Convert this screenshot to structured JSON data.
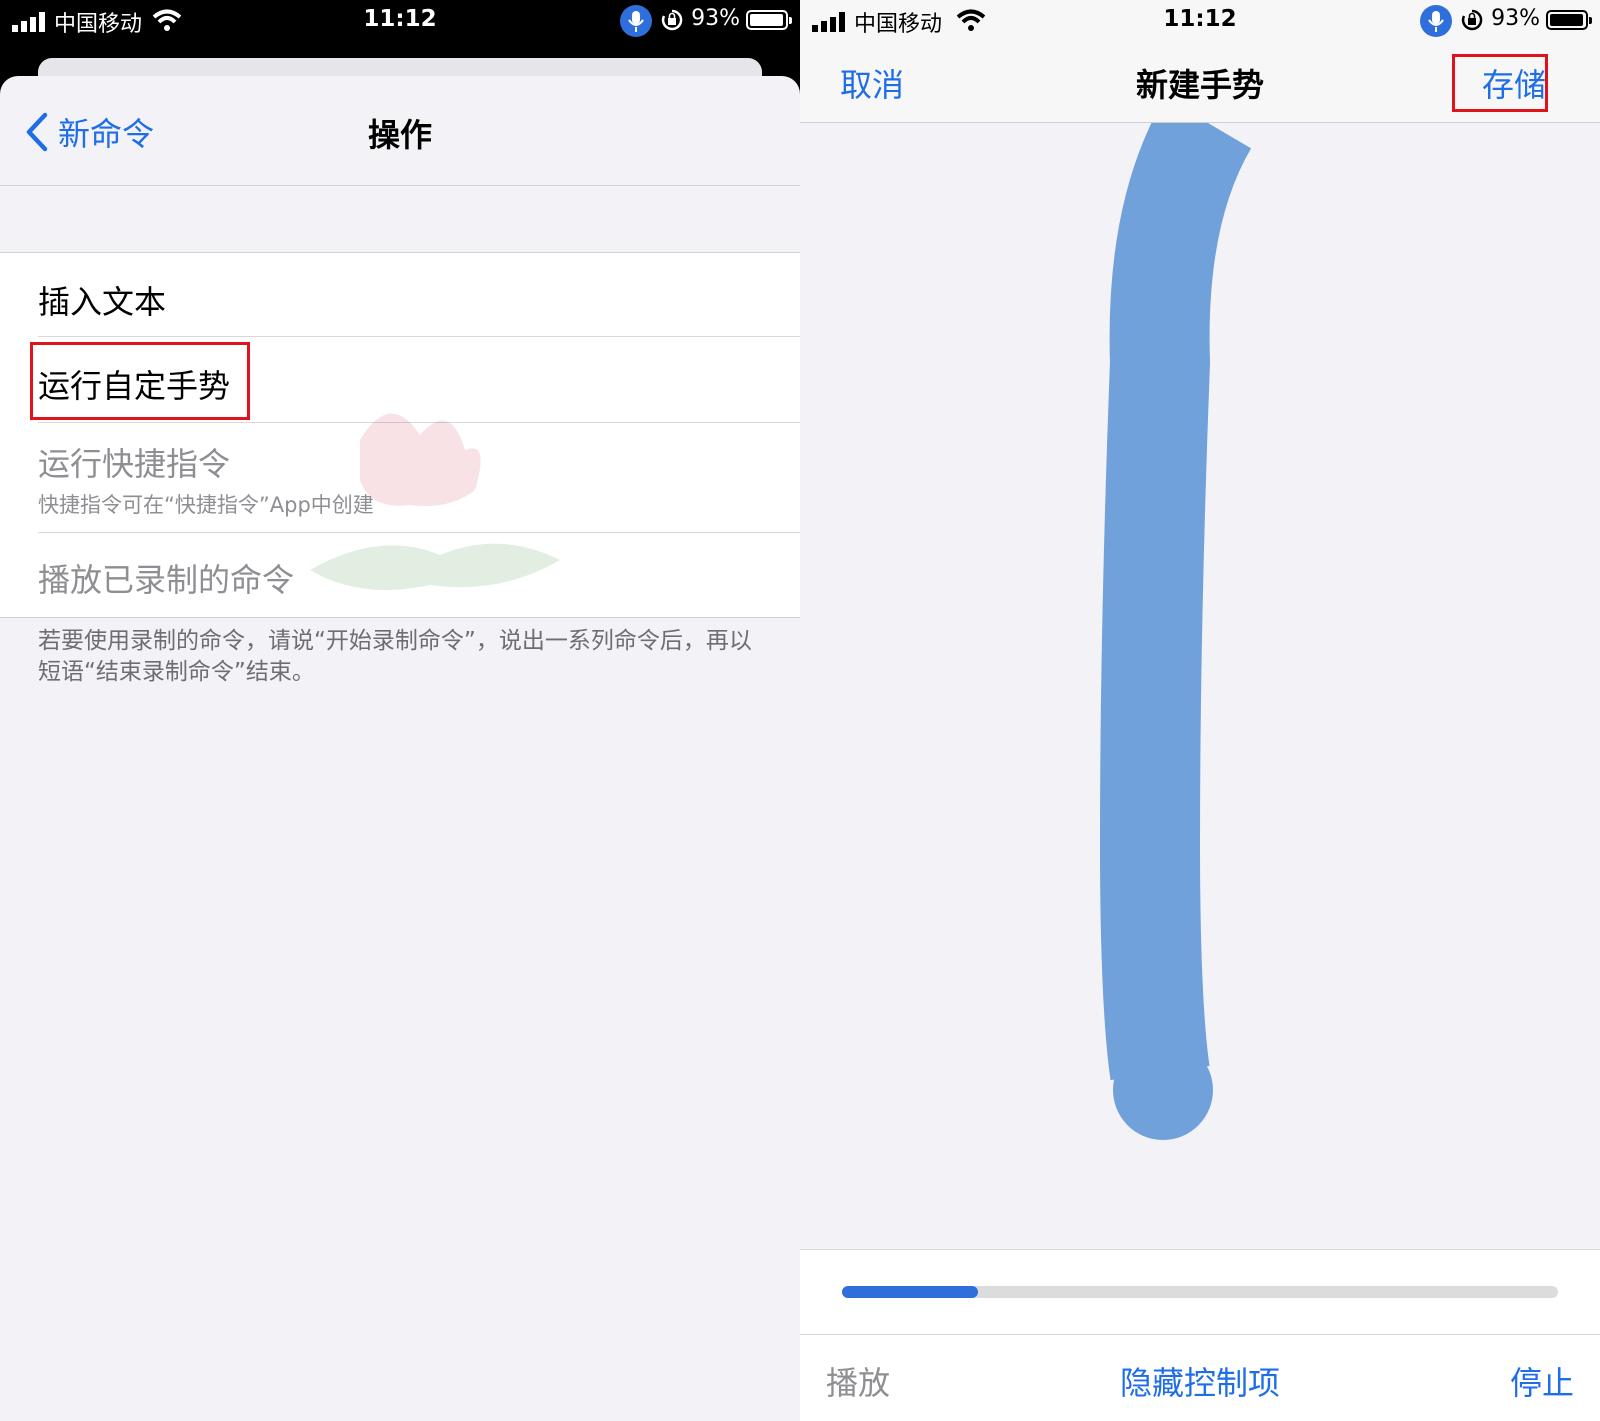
{
  "status_bar": {
    "carrier": "中国移动",
    "time": "11:12",
    "battery": "93%"
  },
  "left_screen": {
    "back_label": "新命令",
    "title": "操作",
    "actions": [
      {
        "label": "插入文本",
        "enabled": true
      },
      {
        "label": "运行自定手势",
        "enabled": true,
        "highlighted": true
      },
      {
        "label": "运行快捷指令",
        "subtitle": "快捷指令可在“快捷指令”App中创建",
        "enabled": false
      },
      {
        "label": "播放已录制的命令",
        "enabled": false
      }
    ],
    "footnote": "若要使用录制的命令，请说“开始录制命令”，说出一系列命令后，再以短语“结束录制命令”结束。"
  },
  "right_screen": {
    "cancel_label": "取消",
    "title": "新建手势",
    "save_label": "存储",
    "playback_progress": 0.19,
    "play_label": "播放",
    "hide_controls_label": "隐藏控制项",
    "stop_label": "停止"
  },
  "colors": {
    "accent": "#1f6ee8",
    "highlight_box": "#e0121b",
    "gesture_stroke": "#71a1da",
    "disabled_text": "#8e8e93"
  }
}
